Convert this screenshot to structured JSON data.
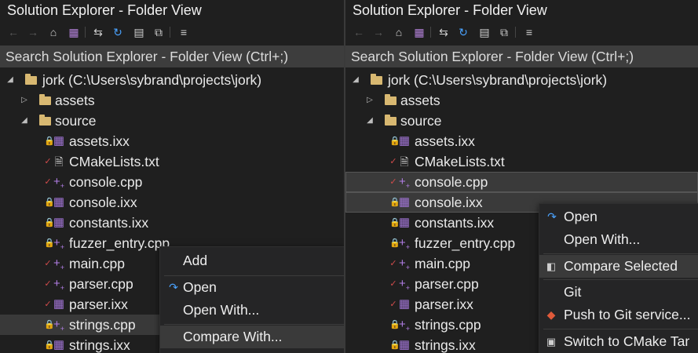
{
  "left": {
    "title": "Solution Explorer - Folder View",
    "search_placeholder": "Search Solution Explorer - Folder View (Ctrl+;)",
    "tree": {
      "root": "jork (C:\\Users\\sybrand\\projects\\jork)",
      "folders": [
        "assets",
        "source"
      ],
      "files": [
        "assets.ixx",
        "CMakeLists.txt",
        "console.cpp",
        "console.ixx",
        "constants.ixx",
        "fuzzer_entry.cpp",
        "main.cpp",
        "parser.cpp",
        "parser.ixx",
        "strings.cpp",
        "strings.ixx"
      ]
    },
    "context_menu": {
      "items": [
        "Add",
        "Open",
        "Open With...",
        "Compare With..."
      ]
    }
  },
  "right": {
    "title": "Solution Explorer - Folder View",
    "search_placeholder": "Search Solution Explorer - Folder View (Ctrl+;)",
    "tree": {
      "root": "jork (C:\\Users\\sybrand\\projects\\jork)",
      "folders": [
        "assets",
        "source"
      ],
      "files": [
        "assets.ixx",
        "CMakeLists.txt",
        "console.cpp",
        "console.ixx",
        "constants.ixx",
        "fuzzer_entry.cpp",
        "main.cpp",
        "parser.cpp",
        "parser.ixx",
        "strings.cpp",
        "strings.ixx"
      ]
    },
    "context_menu": {
      "items": [
        "Open",
        "Open With...",
        "Compare Selected",
        "Git",
        "Push to Git service...",
        "Switch to CMake Tar"
      ]
    }
  },
  "icons": {
    "toolbar": [
      "back-icon",
      "forward-icon",
      "home-icon",
      "vs-switch-view-icon",
      "sync-icon",
      "refresh-icon",
      "collapse-all-icon",
      "copy-icon",
      "properties-icon"
    ],
    "file_status": [
      "lock-icon",
      "check-icon"
    ]
  },
  "colors": {
    "background": "#1f1f1f",
    "search_bg": "#3d3d3d",
    "selection": "#393939",
    "menu_bg": "#252526",
    "folder": "#d8b871",
    "accent_blue": "#4aa3ff",
    "status_red": "#d14b4b",
    "module_purple": "#a074d4"
  }
}
